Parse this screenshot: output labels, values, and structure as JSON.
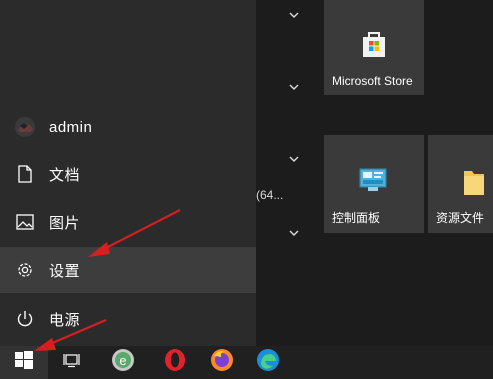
{
  "start_menu": {
    "user": {
      "name": "admin"
    },
    "items": [
      {
        "label": "文档",
        "icon": "document-icon"
      },
      {
        "label": "图片",
        "icon": "picture-icon"
      },
      {
        "label": "设置",
        "icon": "gear-icon"
      },
      {
        "label": "电源",
        "icon": "power-icon"
      }
    ],
    "selected": "设置"
  },
  "app_list": {
    "partial_text": "(64..."
  },
  "tiles": [
    {
      "label": "Microsoft Store",
      "icon": "microsoft-store-icon"
    },
    {
      "label": "控制面板",
      "icon": "control-panel-icon"
    },
    {
      "label": "资源文件",
      "icon": "folder-icon"
    }
  ],
  "taskbar": {
    "items": [
      "windows-start-icon",
      "task-view-icon",
      "browser-e-icon",
      "opera-icon",
      "firefox-icon",
      "edge-icon"
    ]
  },
  "colors": {
    "arrow": "#d61f1f",
    "selected_bg": "#3d3d3d",
    "menu_bg": "#2b2b2b",
    "tile_bg": "#3a3a3a"
  }
}
